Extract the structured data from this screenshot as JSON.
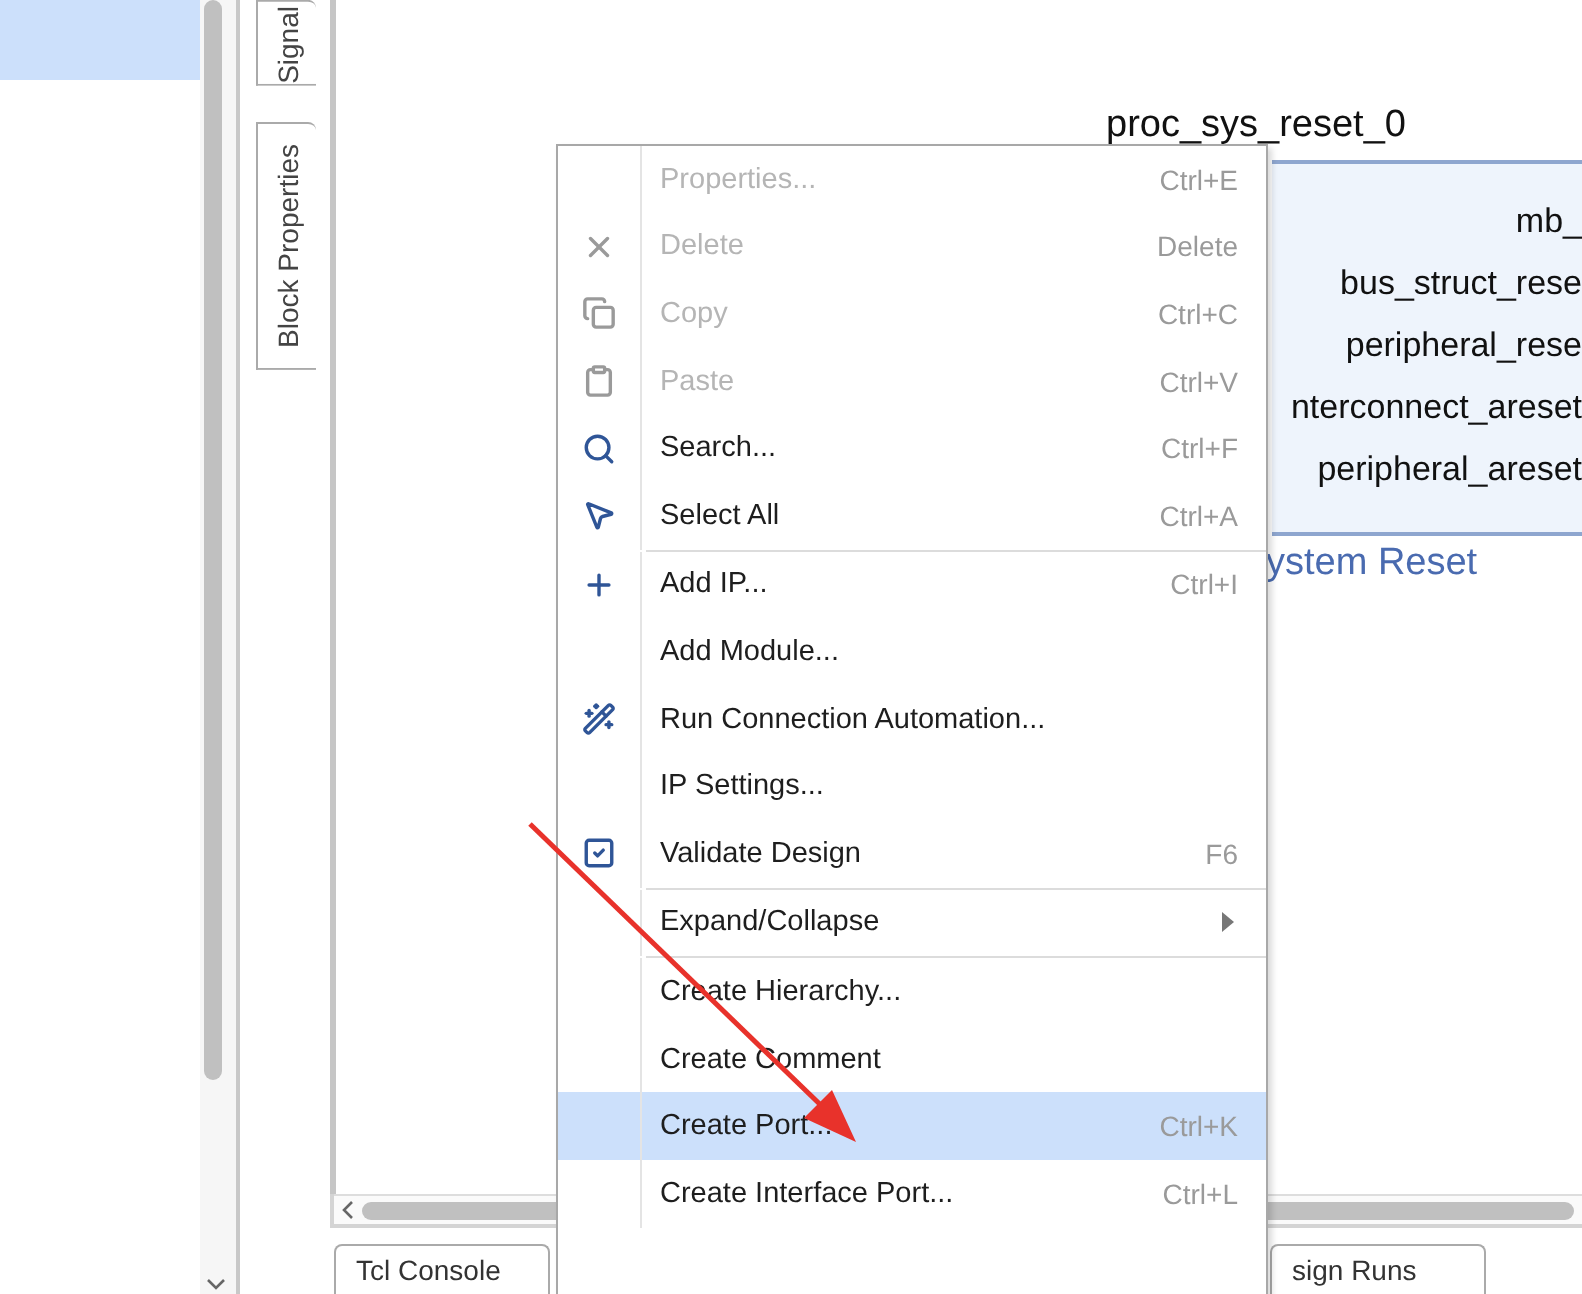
{
  "left_panel": {
    "rows": [
      {
        "selected": true
      }
    ]
  },
  "side_tabs": [
    {
      "label": "Signal"
    },
    {
      "label": "Block Properties"
    }
  ],
  "canvas": {
    "block": {
      "title": "proc_sys_reset_0",
      "ports": [
        "mb_",
        "bus_struct_rese",
        "peripheral_rese",
        "nterconnect_areset",
        "peripheral_areset"
      ],
      "caption": "ystem Reset"
    }
  },
  "context_menu": {
    "entries": [
      {
        "kind": "item",
        "label": "Properties...",
        "shortcut": "Ctrl+E",
        "disabled": true,
        "selected": false
      },
      {
        "kind": "item",
        "label": "Delete",
        "shortcut": "Delete",
        "disabled": true,
        "selected": false
      },
      {
        "kind": "item",
        "label": "Copy",
        "shortcut": "Ctrl+C",
        "disabled": true,
        "selected": false
      },
      {
        "kind": "item",
        "label": "Paste",
        "shortcut": "Ctrl+V",
        "disabled": true,
        "selected": false
      },
      {
        "kind": "item",
        "label": "Search...",
        "shortcut": "Ctrl+F",
        "disabled": false,
        "selected": false
      },
      {
        "kind": "item",
        "label": "Select All",
        "shortcut": "Ctrl+A",
        "disabled": false,
        "selected": false
      },
      {
        "kind": "separator"
      },
      {
        "kind": "item",
        "label": "Add IP...",
        "shortcut": "Ctrl+I",
        "disabled": false,
        "selected": false
      },
      {
        "kind": "item",
        "label": "Add Module...",
        "disabled": false,
        "selected": false
      },
      {
        "kind": "item",
        "label": "Run Connection Automation...",
        "disabled": false,
        "selected": false
      },
      {
        "kind": "item",
        "label": "IP Settings...",
        "disabled": false,
        "selected": false
      },
      {
        "kind": "item",
        "label": "Validate Design",
        "shortcut": "F6",
        "disabled": false,
        "selected": false
      },
      {
        "kind": "separator"
      },
      {
        "kind": "item",
        "label": "Expand/Collapse",
        "submenu": true,
        "disabled": false,
        "selected": false
      },
      {
        "kind": "separator"
      },
      {
        "kind": "item",
        "label": "Create Hierarchy...",
        "disabled": false,
        "selected": false
      },
      {
        "kind": "item",
        "label": "Create Comment",
        "disabled": false,
        "selected": false
      },
      {
        "kind": "item",
        "label": "Create Port...",
        "shortcut": "Ctrl+K",
        "disabled": false,
        "selected": true
      },
      {
        "kind": "item",
        "label": "Create Interface Port...",
        "shortcut": "Ctrl+L",
        "disabled": false,
        "selected": false
      }
    ]
  },
  "bottom_tabs": [
    {
      "label": "Tcl Console"
    },
    {
      "label": "sign Runs"
    }
  ]
}
